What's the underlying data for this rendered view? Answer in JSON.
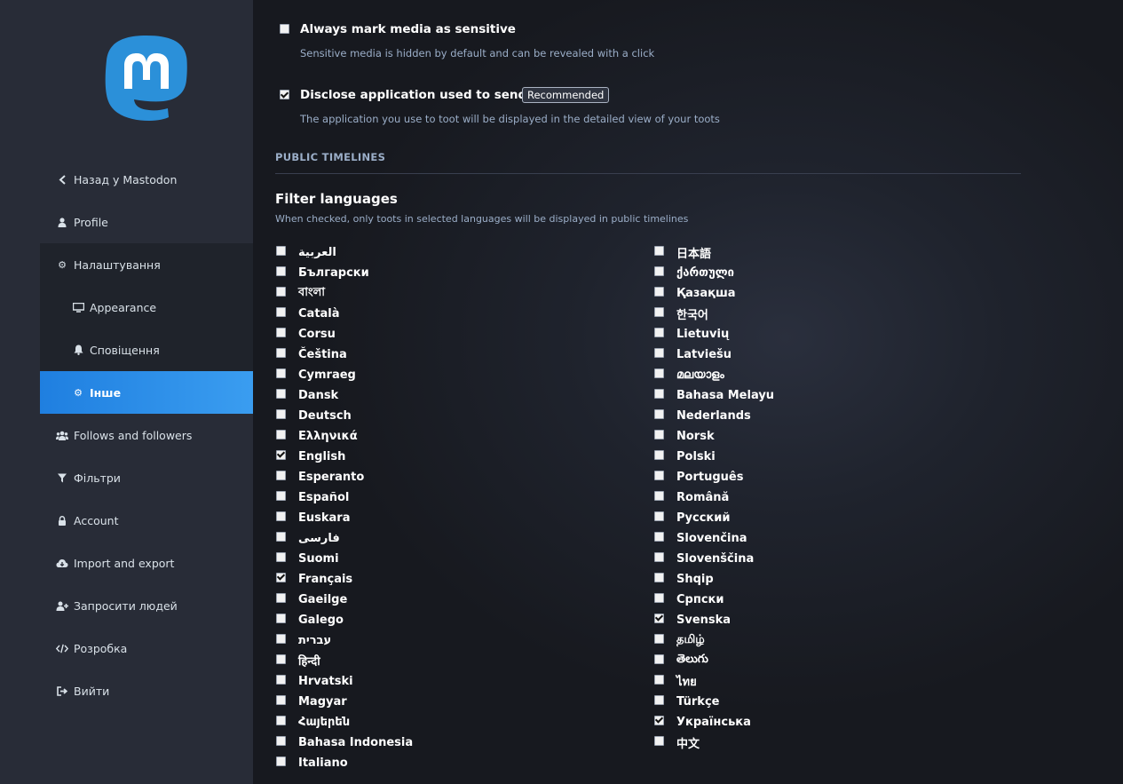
{
  "logo": {
    "icon": "mastodon-logo-icon",
    "color": "#2b90d9"
  },
  "sidebar": {
    "items": [
      {
        "label": "Назад у Mastodon",
        "icon": "chevron-left-icon"
      },
      {
        "label": "Profile",
        "icon": "user-icon"
      },
      {
        "label": "Налаштування",
        "icon": "gear-icon"
      },
      {
        "label": "Appearance",
        "icon": "desktop-icon"
      },
      {
        "label": "Сповіщення",
        "icon": "bell-icon"
      },
      {
        "label": "Інше",
        "icon": "gear-icon"
      },
      {
        "label": "Follows and followers",
        "icon": "users-icon"
      },
      {
        "label": "Фільтри",
        "icon": "filter-icon"
      },
      {
        "label": "Account",
        "icon": "lock-icon"
      },
      {
        "label": "Import and export",
        "icon": "cloud-download-icon"
      },
      {
        "label": "Запросити людей",
        "icon": "user-plus-icon"
      },
      {
        "label": "Розробка",
        "icon": "code-icon"
      },
      {
        "label": "Вийти",
        "icon": "sign-out-icon"
      }
    ],
    "active_index": 5
  },
  "options": {
    "sensitive": {
      "label": "Always mark media as sensitive",
      "hint": "Sensitive media is hidden by default and can be revealed with a click",
      "checked": false
    },
    "disclose": {
      "label": "Disclose application used to send toots",
      "badge": "Recommended",
      "hint": "The application you use to toot will be displayed in the detailed view of your toots",
      "checked": true
    }
  },
  "public_timelines": {
    "section_title": "PUBLIC TIMELINES",
    "filter_title": "Filter languages",
    "filter_hint": "When checked, only toots in selected languages will be displayed in public timelines"
  },
  "languages_left": [
    {
      "name": "العربية",
      "checked": false
    },
    {
      "name": "Български",
      "checked": false
    },
    {
      "name": "বাংলা",
      "checked": false
    },
    {
      "name": "Català",
      "checked": false
    },
    {
      "name": "Corsu",
      "checked": false
    },
    {
      "name": "Čeština",
      "checked": false
    },
    {
      "name": "Cymraeg",
      "checked": false
    },
    {
      "name": "Dansk",
      "checked": false
    },
    {
      "name": "Deutsch",
      "checked": false
    },
    {
      "name": "Ελληνικά",
      "checked": false
    },
    {
      "name": "English",
      "checked": true
    },
    {
      "name": "Esperanto",
      "checked": false
    },
    {
      "name": "Español",
      "checked": false
    },
    {
      "name": "Euskara",
      "checked": false
    },
    {
      "name": "فارسی",
      "checked": false
    },
    {
      "name": "Suomi",
      "checked": false
    },
    {
      "name": "Français",
      "checked": true
    },
    {
      "name": "Gaeilge",
      "checked": false
    },
    {
      "name": "Galego",
      "checked": false
    },
    {
      "name": "עברית",
      "checked": false
    },
    {
      "name": "हिन्दी",
      "checked": false
    },
    {
      "name": "Hrvatski",
      "checked": false
    },
    {
      "name": "Magyar",
      "checked": false
    },
    {
      "name": "Հայերեն",
      "checked": false
    },
    {
      "name": "Bahasa Indonesia",
      "checked": false
    },
    {
      "name": "Italiano",
      "checked": false
    }
  ],
  "languages_right": [
    {
      "name": "日本語",
      "checked": false
    },
    {
      "name": "ქართული",
      "checked": false
    },
    {
      "name": "Қазақша",
      "checked": false
    },
    {
      "name": "한국어",
      "checked": false
    },
    {
      "name": "Lietuvių",
      "checked": false
    },
    {
      "name": "Latviešu",
      "checked": false
    },
    {
      "name": "മലയാളം",
      "checked": false
    },
    {
      "name": "Bahasa Melayu",
      "checked": false
    },
    {
      "name": "Nederlands",
      "checked": false
    },
    {
      "name": "Norsk",
      "checked": false
    },
    {
      "name": "Polski",
      "checked": false
    },
    {
      "name": "Português",
      "checked": false
    },
    {
      "name": "Română",
      "checked": false
    },
    {
      "name": "Русский",
      "checked": false
    },
    {
      "name": "Slovenčina",
      "checked": false
    },
    {
      "name": "Slovenščina",
      "checked": false
    },
    {
      "name": "Shqip",
      "checked": false
    },
    {
      "name": "Српски",
      "checked": false
    },
    {
      "name": "Svenska",
      "checked": true
    },
    {
      "name": "தமிழ்",
      "checked": false
    },
    {
      "name": "తెలుగు",
      "checked": false
    },
    {
      "name": "ไทย",
      "checked": false
    },
    {
      "name": "Türkçe",
      "checked": false
    },
    {
      "name": "Українська",
      "checked": true
    },
    {
      "name": "中文",
      "checked": false
    }
  ]
}
